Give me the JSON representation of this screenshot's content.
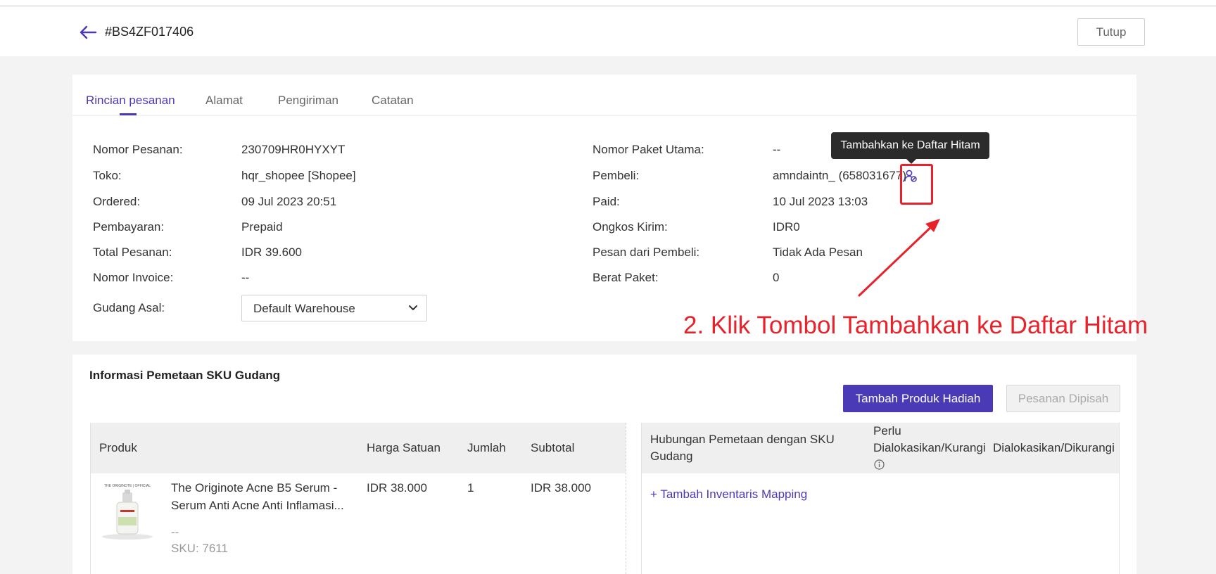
{
  "header": {
    "order_id": "#BS4ZF017406",
    "close_label": "Tutup"
  },
  "tabs": [
    {
      "label": "Rincian pesanan",
      "active": true
    },
    {
      "label": "Alamat",
      "active": false
    },
    {
      "label": "Pengiriman",
      "active": false
    },
    {
      "label": "Catatan",
      "active": false
    }
  ],
  "details_left": [
    {
      "label": "Nomor Pesanan:",
      "value": "230709HR0HYXYT"
    },
    {
      "label": "Toko:",
      "value": "hqr_shopee [Shopee]"
    },
    {
      "label": "Ordered:",
      "value": "09 Jul 2023 20:51"
    },
    {
      "label": "Pembayaran:",
      "value": "Prepaid"
    },
    {
      "label": "Total Pesanan:",
      "value": "IDR 39.600"
    },
    {
      "label": "Nomor Invoice:",
      "value": "--"
    }
  ],
  "warehouse": {
    "label": "Gudang Asal:",
    "selected": "Default Warehouse"
  },
  "details_right": [
    {
      "label": "Nomor Paket Utama:",
      "value": "--"
    },
    {
      "label": "Pembeli:",
      "value": "amndaintn_ (658031677)"
    },
    {
      "label": "Paid:",
      "value": "10 Jul 2023 13:03"
    },
    {
      "label": "Ongkos Kirim:",
      "value": "IDR0"
    },
    {
      "label": "Pesan dari Pembeli:",
      "value": "Tidak Ada Pesan"
    },
    {
      "label": "Berat Paket:",
      "value": "0"
    }
  ],
  "tooltip": {
    "text": "Tambahkan ke Daftar Hitam"
  },
  "annotation": {
    "text": "2. Klik Tombol Tambahkan ke Daftar Hitam",
    "color": "#e8222b"
  },
  "sku_section": {
    "title": "Informasi Pemetaan SKU Gudang",
    "add_gift_label": "Tambah Produk Hadiah",
    "split_order_label": "Pesanan Dipisah",
    "left_headers": {
      "product": "Produk",
      "unit_price": "Harga Satuan",
      "qty": "Jumlah",
      "subtotal": "Subtotal"
    },
    "right_headers": {
      "mapping_line1": "Hubungan Pemetaan dengan SKU",
      "mapping_line2": "Gudang",
      "allocate_line1": "Perlu",
      "allocate_line2": "Dialokasikan/Kurangi",
      "allocated": "Dialokasikan/Dikurangi"
    },
    "product_row": {
      "brand_text": "THE ORIGINOTE | OFFICIAL",
      "name_line1": "The Originote Acne B5 Serum -",
      "name_line2": "Serum Anti Acne Anti Inflamasi...",
      "variant": "--",
      "sku": "SKU: 7611",
      "unit_price": "IDR 38.000",
      "qty": "1",
      "subtotal": "IDR 38.000"
    },
    "add_mapping_label": "+ Tambah Inventaris Mapping"
  },
  "colors": {
    "accent": "#4a3ab6",
    "annotation": "#e8222b",
    "tooltip_bg": "#2b2b2b"
  }
}
